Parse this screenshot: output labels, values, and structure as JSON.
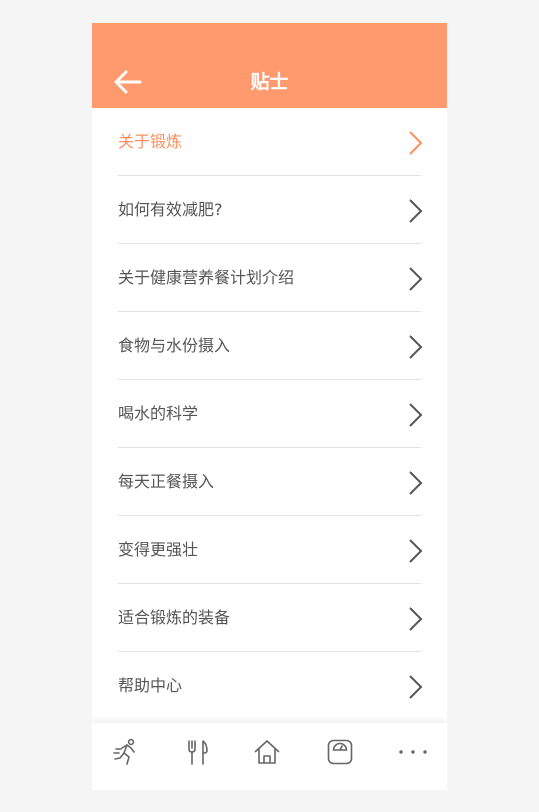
{
  "header": {
    "title": "贴士",
    "back_icon": "arrow-left-icon"
  },
  "tips": [
    {
      "label": "关于锻炼",
      "active": true
    },
    {
      "label": "如何有效减肥?",
      "active": false
    },
    {
      "label": "关于健康营养餐计划介绍",
      "active": false
    },
    {
      "label": "食物与水份摄入",
      "active": false
    },
    {
      "label": "喝水的科学",
      "active": false
    },
    {
      "label": "每天正餐摄入",
      "active": false
    },
    {
      "label": "变得更强壮",
      "active": false
    },
    {
      "label": "适合锻炼的装备",
      "active": false
    },
    {
      "label": "帮助中心",
      "active": false
    }
  ],
  "tabbar": {
    "items": [
      {
        "icon": "running-icon"
      },
      {
        "icon": "fork-knife-icon"
      },
      {
        "icon": "home-icon"
      },
      {
        "icon": "scale-icon"
      },
      {
        "icon": "more-dots-icon"
      }
    ]
  },
  "colors": {
    "accent": "#ff9a6e",
    "active_text": "#ff8f5e",
    "text": "#555555",
    "icon": "#666666"
  }
}
